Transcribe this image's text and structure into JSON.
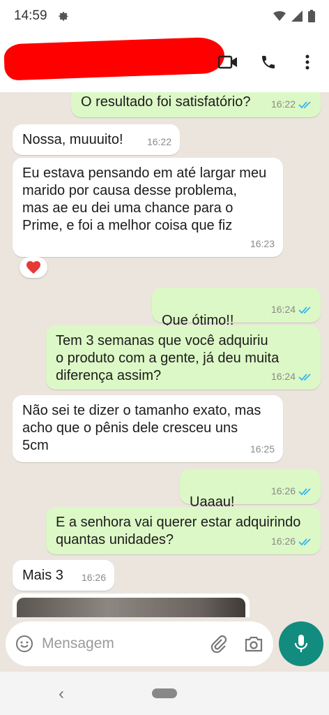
{
  "status": {
    "time": "14:59"
  },
  "header": {
    "contact_name_redacted": true
  },
  "messages": [
    {
      "id": "m1",
      "dir": "out",
      "text": "O resultado foi satisfatório?",
      "time": "16:22"
    },
    {
      "id": "m2",
      "dir": "in",
      "text": "Nossa, muuuito!",
      "time": "16:22"
    },
    {
      "id": "m3",
      "dir": "in",
      "text": "Eu estava pensando em até largar meu\nmarido por causa desse problema,\nmas ae eu dei uma chance para o\nPrime, e foi a melhor coisa que fiz",
      "time": "16:23"
    },
    {
      "id": "m4",
      "dir": "out",
      "text": "Que ótimo!!",
      "time": "16:24"
    },
    {
      "id": "m5",
      "dir": "out",
      "text": "Tem 3 semanas que você adquiriu\no produto com a gente, já deu muita\ndiferença assim?",
      "time": "16:24"
    },
    {
      "id": "m6",
      "dir": "in",
      "text": "Não sei te dizer o tamanho exato, mas\nacho que o pênis dele cresceu uns\n5cm",
      "time": "16:25"
    },
    {
      "id": "m7",
      "dir": "out",
      "text": "Uaaau!",
      "time": "16:26"
    },
    {
      "id": "m8",
      "dir": "out",
      "text": "E a senhora vai querer estar adquirindo\nquantas unidades?",
      "time": "16:26"
    },
    {
      "id": "m9",
      "dir": "in",
      "text": "Mais 3",
      "time": "16:26"
    }
  ],
  "reaction": {
    "icon": "heart-icon",
    "color": "#e53935"
  },
  "composer": {
    "placeholder": "Mensagem"
  },
  "colors": {
    "outgoing": "#DCF8C6",
    "incoming": "#FFFFFF",
    "ticks": "#34B7F1",
    "accent": "#128C7E",
    "background": "#ECE5DD"
  }
}
